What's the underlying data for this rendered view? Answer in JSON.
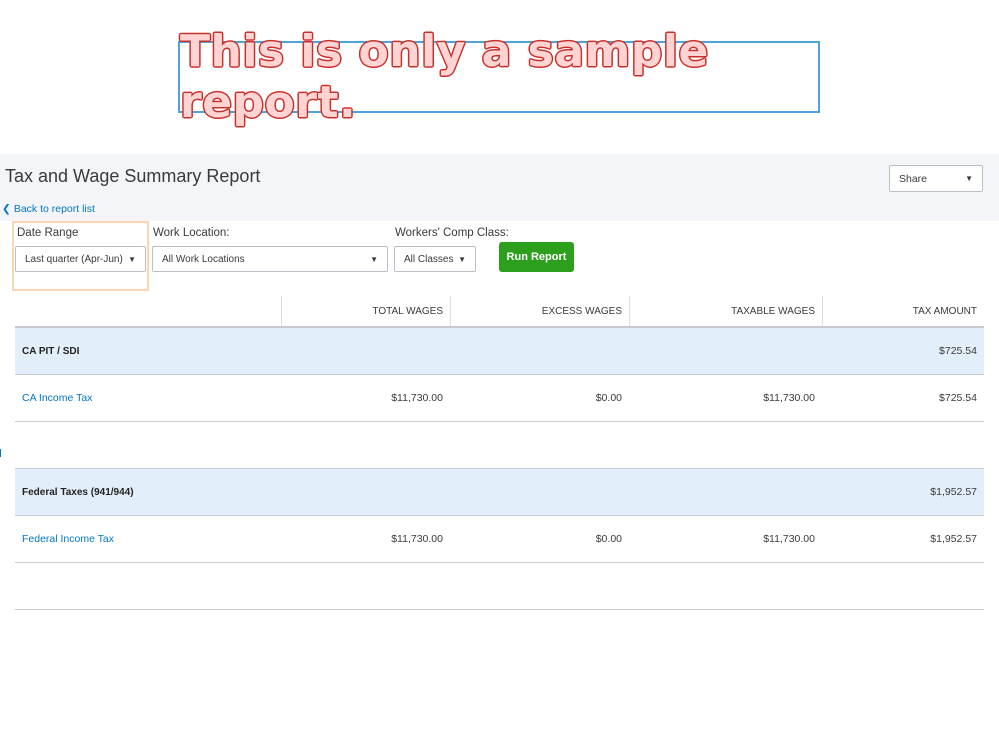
{
  "banner": {
    "text": "This is only a sample report."
  },
  "report": {
    "title": "Tax and Wage Summary Report",
    "back_link": "Back to report list",
    "share": {
      "label": "Share"
    }
  },
  "filters": {
    "date_range": {
      "label": "Date Range",
      "value": "Last quarter (Apr-Jun)"
    },
    "work_location": {
      "label": "Work Location:",
      "value": "All Work Locations"
    },
    "workers_comp": {
      "label": "Workers' Comp Class:",
      "value": "All Classes"
    },
    "run_report": "Run Report"
  },
  "table": {
    "columns": [
      "",
      "TOTAL WAGES",
      "EXCESS WAGES",
      "TAXABLE WAGES",
      "TAX AMOUNT"
    ],
    "rows": [
      {
        "type": "group",
        "name": "CA PIT / SDI",
        "total_wages": "",
        "excess_wages": "",
        "taxable_wages": "",
        "tax_amount": "$725.54"
      },
      {
        "type": "item",
        "name": "CA Income Tax",
        "total_wages": "$11,730.00",
        "excess_wages": "$0.00",
        "taxable_wages": "$11,730.00",
        "tax_amount": "$725.54"
      },
      {
        "type": "spacer"
      },
      {
        "type": "group",
        "name": "Federal Taxes (941/944)",
        "total_wages": "",
        "excess_wages": "",
        "taxable_wages": "",
        "tax_amount": "$1,952.57"
      },
      {
        "type": "item",
        "name": "Federal Income Tax",
        "total_wages": "$11,730.00",
        "excess_wages": "$0.00",
        "taxable_wages": "$11,730.00",
        "tax_amount": "$1,952.57"
      },
      {
        "type": "spacer"
      }
    ]
  },
  "colors": {
    "accent_link": "#0077c5",
    "run_button": "#2ca01c",
    "group_row": "#e2eef9",
    "banner_text": "#c9302c"
  },
  "icons": {
    "back": "chevron-left-icon",
    "dropdown": "caret-down-icon"
  }
}
